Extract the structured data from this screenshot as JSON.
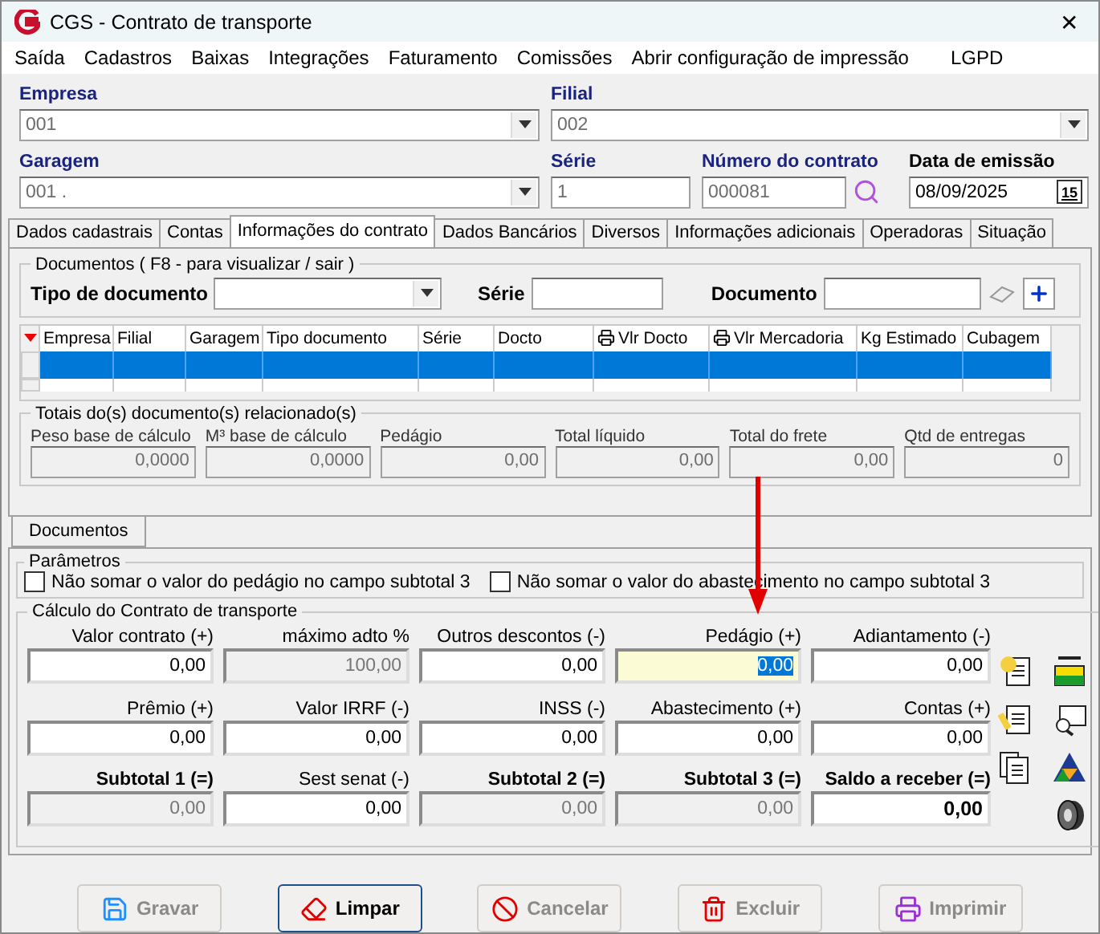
{
  "window": {
    "title": "CGS - Contrato de transporte",
    "close": "✕"
  },
  "menu": [
    "Saída",
    "Cadastros",
    "Baixas",
    "Integrações",
    "Faturamento",
    "Comissões",
    "Abrir configuração de impressão",
    "LGPD"
  ],
  "header": {
    "empresa": {
      "label": "Empresa",
      "value": "001"
    },
    "filial": {
      "label": "Filial",
      "value": "002"
    },
    "garagem": {
      "label": "Garagem",
      "value": "001 ."
    },
    "serie": {
      "label": "Série",
      "value": "1"
    },
    "numero": {
      "label": "Número do contrato",
      "value": "000081"
    },
    "data": {
      "label": "Data de emissão",
      "value": "08/09/2025",
      "button": "15"
    }
  },
  "tabs": [
    {
      "label": "Dados cadastrais",
      "selected": false
    },
    {
      "label": "Contas",
      "selected": false
    },
    {
      "label": "Informações do contrato",
      "selected": true
    },
    {
      "label": "Dados Bancários",
      "selected": false
    },
    {
      "label": "Diversos",
      "selected": false
    },
    {
      "label": "Informações adicionais",
      "selected": false
    },
    {
      "label": "Operadoras",
      "selected": false
    },
    {
      "label": "Situação",
      "selected": false
    }
  ],
  "documents": {
    "legend": "Documentos ( F8 - para visualizar / sair )",
    "tipo_label": "Tipo de documento",
    "serie_label": "Série",
    "documento_label": "Documento",
    "columns": [
      {
        "label": "Empresa",
        "kind": "plain"
      },
      {
        "label": "Filial",
        "kind": "plain"
      },
      {
        "label": "Garagem",
        "kind": "plain"
      },
      {
        "label": "Tipo documento",
        "kind": "plain"
      },
      {
        "label": "Série",
        "kind": "plain"
      },
      {
        "label": "Docto",
        "kind": "plain"
      },
      {
        "label": "Vlr Docto",
        "kind": "print"
      },
      {
        "label": "Vlr Mercadoria",
        "kind": "print"
      },
      {
        "label": "Kg Estimado",
        "kind": "plain"
      },
      {
        "label": "Cubagem",
        "kind": "plain"
      }
    ],
    "rows": [
      {
        "selected": true
      },
      {
        "selected": false
      }
    ]
  },
  "totals": {
    "legend": "Totais do(s) documento(s) relacionado(s)",
    "fields": [
      {
        "label": "Peso base de cálculo",
        "value": "0,0000"
      },
      {
        "label": "M³ base de cálculo",
        "value": "0,0000"
      },
      {
        "label": "Pedágio",
        "value": "0,00"
      },
      {
        "label": "Total líquido",
        "value": "0,00"
      },
      {
        "label": "Total do frete",
        "value": "0,00"
      },
      {
        "label": "Qtd de entregas",
        "value": "0"
      }
    ]
  },
  "bottom_tab": "Documentos",
  "parametros": {
    "legend": "Parâmetros",
    "options": [
      {
        "label": "Não somar o valor do pedágio no campo subtotal 3",
        "checked": false
      },
      {
        "label": "Não somar o valor do abastecimento no campo subtotal 3",
        "checked": false
      }
    ]
  },
  "calculo": {
    "legend": "Cálculo do Contrato de transporte",
    "rows": [
      [
        {
          "label": "Valor contrato (+)",
          "value": "0,00",
          "disabled": false,
          "focused": false,
          "emphasis": false
        },
        {
          "label": "máximo adto %",
          "value": "100,00",
          "disabled": true,
          "focused": false,
          "emphasis": false
        },
        {
          "label": "Outros descontos (-)",
          "value": "0,00",
          "disabled": false,
          "focused": false,
          "emphasis": false
        },
        {
          "label": "Pedágio (+)",
          "value": "0,00",
          "disabled": false,
          "focused": true,
          "emphasis": false
        },
        {
          "label": "Adiantamento (-)",
          "value": "0,00",
          "disabled": false,
          "focused": false,
          "emphasis": false
        }
      ],
      [
        {
          "label": "Prêmio (+)",
          "value": "0,00",
          "disabled": false,
          "focused": false,
          "emphasis": false
        },
        {
          "label": "Valor IRRF (-)",
          "value": "0,00",
          "disabled": false,
          "focused": false,
          "emphasis": false
        },
        {
          "label": "INSS (-)",
          "value": "0,00",
          "disabled": false,
          "focused": false,
          "emphasis": false
        },
        {
          "label": "Abastecimento (+)",
          "value": "0,00",
          "disabled": false,
          "focused": false,
          "emphasis": false
        },
        {
          "label": "Contas (+)",
          "value": "0,00",
          "disabled": false,
          "focused": false,
          "emphasis": false
        }
      ],
      [
        {
          "label": "Subtotal 1 (=)",
          "value": "0,00",
          "disabled": true,
          "focused": false,
          "emphasis": true
        },
        {
          "label": "Sest senat (-)",
          "value": "0,00",
          "disabled": false,
          "focused": false,
          "emphasis": false
        },
        {
          "label": "Subtotal 2 (=)",
          "value": "0,00",
          "disabled": true,
          "focused": false,
          "emphasis": true
        },
        {
          "label": "Subtotal 3 (=)",
          "value": "0,00",
          "disabled": true,
          "focused": false,
          "emphasis": true
        },
        {
          "label": "Saldo a receber (=)",
          "value": "0,00",
          "disabled": false,
          "focused": false,
          "emphasis": true
        }
      ]
    ]
  },
  "buttons": [
    {
      "label": "Gravar",
      "kind": "save",
      "disabled": true,
      "selected": false
    },
    {
      "label": "Limpar",
      "kind": "eraser",
      "disabled": false,
      "selected": true
    },
    {
      "label": "Cancelar",
      "kind": "cancel",
      "disabled": true,
      "selected": false
    },
    {
      "label": "Excluir",
      "kind": "trash",
      "disabled": true,
      "selected": false
    },
    {
      "label": "Imprimir",
      "kind": "print",
      "disabled": true,
      "selected": false
    }
  ]
}
